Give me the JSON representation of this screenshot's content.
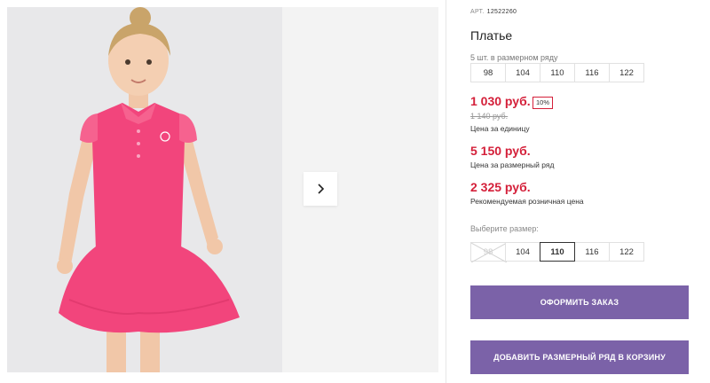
{
  "product": {
    "article_label": "АРТ.",
    "article_code": "12522260",
    "title": "Платье",
    "set_caption": "5 шт. в размерном ряду",
    "set_sizes": [
      "98",
      "104",
      "110",
      "116",
      "122"
    ],
    "price_unit": "1 030 руб.",
    "discount_badge": "10%",
    "old_price": "1 140 руб.",
    "price_unit_caption": "Цена за единицу",
    "price_set": "5 150 руб.",
    "price_set_caption": "Цена за размерный ряд",
    "price_retail": "2 325 руб.",
    "price_retail_caption": "Рекомендуемая розничная цена",
    "choose_size_label": "Выберите размер:",
    "select_sizes": [
      {
        "label": "98",
        "state": "unavailable"
      },
      {
        "label": "104",
        "state": "available"
      },
      {
        "label": "110",
        "state": "selected"
      },
      {
        "label": "116",
        "state": "available"
      },
      {
        "label": "122",
        "state": "available"
      }
    ]
  },
  "actions": {
    "order_label": "ОФОРМИТЬ ЗАКАЗ",
    "add_set_label": "ДОБАВИТЬ РАЗМЕРНЫЙ РЯД В КОРЗИНУ"
  },
  "colors": {
    "accent_purple": "#7b62a8",
    "price_red": "#d4203a",
    "dress_pink": "#f2457c"
  },
  "icons": {
    "next": "chevron-right-icon"
  }
}
